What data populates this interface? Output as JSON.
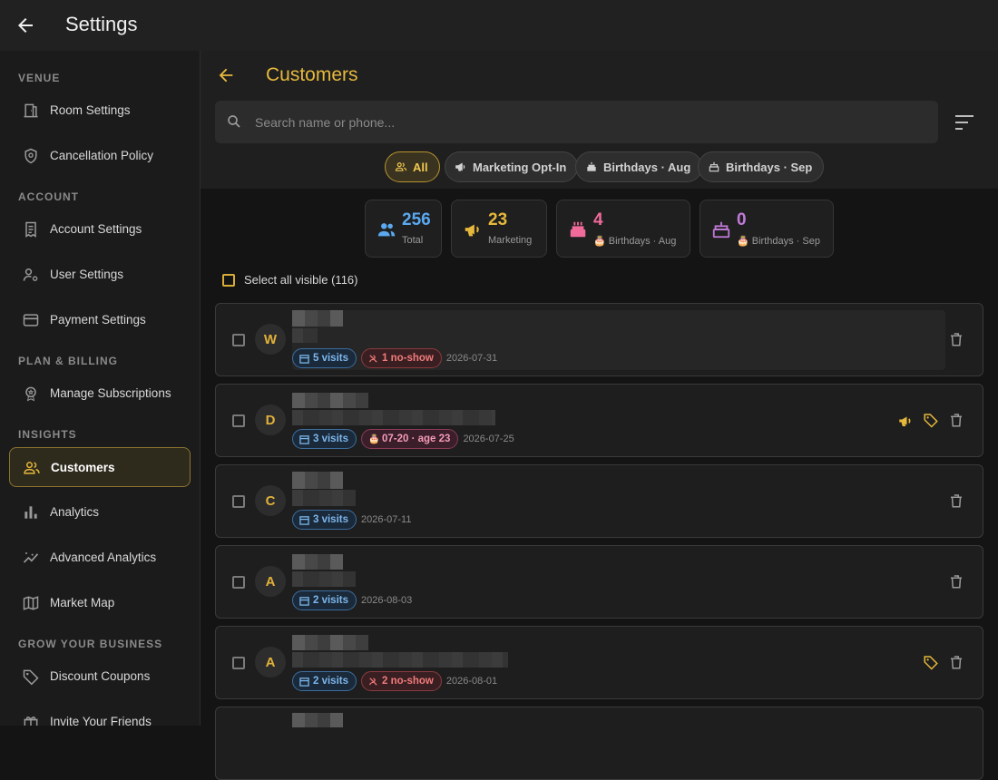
{
  "app": {
    "title": "Settings"
  },
  "sidebar": {
    "sections": [
      {
        "title": "VENUE",
        "items": [
          {
            "label": "Room Settings",
            "icon": "door-icon"
          },
          {
            "label": "Cancellation Policy",
            "icon": "shield-icon"
          }
        ]
      },
      {
        "title": "ACCOUNT",
        "items": [
          {
            "label": "Account Settings",
            "icon": "receipt-icon"
          },
          {
            "label": "User Settings",
            "icon": "user-gear-icon"
          },
          {
            "label": "Payment Settings",
            "icon": "credit-card-icon"
          }
        ]
      },
      {
        "title": "PLAN & BILLING",
        "items": [
          {
            "label": "Manage Subscriptions",
            "icon": "award-icon"
          }
        ]
      },
      {
        "title": "INSIGHTS",
        "items": [
          {
            "label": "Customers",
            "icon": "people-icon",
            "active": true
          },
          {
            "label": "Analytics",
            "icon": "bar-chart-icon"
          },
          {
            "label": "Advanced Analytics",
            "icon": "trend-icon"
          },
          {
            "label": "Market Map",
            "icon": "map-icon"
          }
        ]
      },
      {
        "title": "GROW YOUR BUSINESS",
        "items": [
          {
            "label": "Discount Coupons",
            "icon": "tag-icon"
          },
          {
            "label": "Invite Your Friends",
            "icon": "gift-icon"
          }
        ]
      }
    ]
  },
  "main": {
    "title": "Customers",
    "search_placeholder": "Search name or phone...",
    "filters": [
      {
        "label": "All",
        "icon": "people-icon",
        "active": true
      },
      {
        "label": "Marketing Opt-In",
        "icon": "megaphone-icon"
      },
      {
        "label": "Birthdays · Aug",
        "icon": "cake-icon"
      },
      {
        "label": "Birthdays · Sep",
        "icon": "cake-icon"
      }
    ],
    "stats": [
      {
        "value": "256",
        "label": "Total",
        "icon": "people-icon",
        "color": "#5aa9f0"
      },
      {
        "value": "23",
        "label": "Marketing",
        "icon": "megaphone-icon",
        "color": "#e6b83c"
      },
      {
        "value": "4",
        "label": "🎂 Birthdays · Aug",
        "icon": "cake-icon",
        "color": "#f06a9a"
      },
      {
        "value": "0",
        "label": "🎂 Birthdays · Sep",
        "icon": "cake-icon",
        "color": "#c07ad8"
      }
    ],
    "select_all": "Select all visible (116)",
    "customers": [
      {
        "initial": "W",
        "visits": "5 visits",
        "noshow": "1 no-show",
        "birthday": "",
        "date": "2026-07-31",
        "marketing": false,
        "tagged": false
      },
      {
        "initial": "D",
        "visits": "3 visits",
        "noshow": "",
        "birthday": "07-20 · age 23",
        "date": "2026-07-25",
        "marketing": true,
        "tagged": true
      },
      {
        "initial": "C",
        "visits": "3 visits",
        "noshow": "",
        "birthday": "",
        "date": "2026-07-11",
        "marketing": false,
        "tagged": false
      },
      {
        "initial": "A",
        "visits": "2 visits",
        "noshow": "",
        "birthday": "",
        "date": "2026-08-03",
        "marketing": false,
        "tagged": false
      },
      {
        "initial": "A",
        "visits": "2 visits",
        "noshow": "2 no-show",
        "birthday": "",
        "date": "2026-08-01",
        "marketing": false,
        "tagged": true
      }
    ]
  },
  "colors": {
    "accent": "#e6b83c",
    "visit": "#7cb6ec",
    "noshow": "#f07a7a",
    "birthday": "#f59ab5"
  }
}
